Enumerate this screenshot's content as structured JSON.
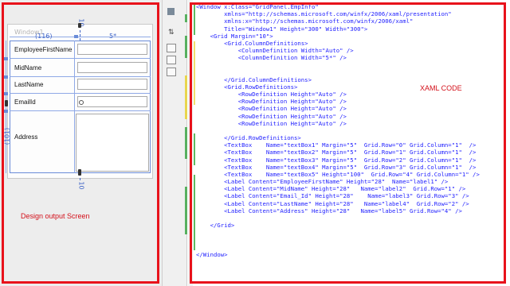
{
  "design": {
    "window_title": "Window1",
    "col_width_auto": "(116)",
    "col_width_star": "5*",
    "row_height": "(101)",
    "margin_top": "10",
    "margin_bottom": "10",
    "labels": [
      "EmployeeFirstName",
      "MidName",
      "LastName",
      "EmailId",
      "Address"
    ],
    "caption": "Design output Screen"
  },
  "editor": {
    "caption": "XAML CODE",
    "lines": [
      "<Window x:Class=\"GridPanel.EmpInfo\"",
      "        xmlns=\"http://schemas.microsoft.com/winfx/2006/xaml/presentation\"",
      "        xmlns:x=\"http://schemas.microsoft.com/winfx/2006/xaml\"",
      "        Title=\"Window1\" Height=\"300\" Width=\"300\">",
      "    <Grid Margin=\"10\">",
      "        <Grid.ColumnDefinitions>",
      "            <ColumnDefinition Width=\"Auto\" />",
      "            <ColumnDefinition Width=\"5*\" />",
      "",
      "",
      "        </Grid.ColumnDefinitions>",
      "        <Grid.RowDefinitions>",
      "            <RowDefinition Height=\"Auto\" />",
      "            <RowDefinition Height=\"Auto\" />",
      "            <RowDefinition Height=\"Auto\" />",
      "            <RowDefinition Height=\"Auto\" />",
      "            <RowDefinition Height=\"Auto\" />",
      "",
      "        </Grid.RowDefinitions>",
      "        <TextBox    Name=\"textBox1\" Margin=\"5\"  Grid.Row=\"0\" Grid.Column=\"1\"  />",
      "        <TextBox    Name=\"textBox2\" Margin=\"5\"  Grid.Row=\"1\" Grid.Column=\"1\"  />",
      "        <TextBox    Name=\"textBox3\" Margin=\"5\"  Grid.Row=\"2\" Grid.Column=\"1\"  />",
      "        <TextBox    Name=\"textBox4\" Margin=\"5\"  Grid.Row=\"3\" Grid.Column=\"1\"  />",
      "        <TextBox    Name=\"textBox5\" Height=\"100\"  Grid.Row=\"4\" Grid.Column=\"1\" />",
      "        <Label Content=\"EmployeeFirstName\" Height=\"28\"  Name=\"label1\" />",
      "        <Label Content=\"MidName\" Height=\"28\"   Name=\"label2\"  Grid.Row=\"1\" />",
      "        <Label Content=\"Email_Id\" Height=\"28\"    Name=\"label3\" Grid.Row=\"3\" />",
      "        <Label Content=\"LastName\" Height=\"28\"   Name=\"label4\"  Grid.Row=\"2\" />",
      "        <Label Content=\"Address\" Height=\"28\"   Name=\"label5\" Grid.Row=\"4\" />",
      "",
      "    </Grid>",
      "",
      "",
      "",
      "</Window>"
    ]
  },
  "colors": {
    "highlight_border": "#e8121b",
    "xaml_markup": "#2323ff",
    "change_marker": "#5dbb63",
    "grid_guide": "#6a8cd8"
  }
}
